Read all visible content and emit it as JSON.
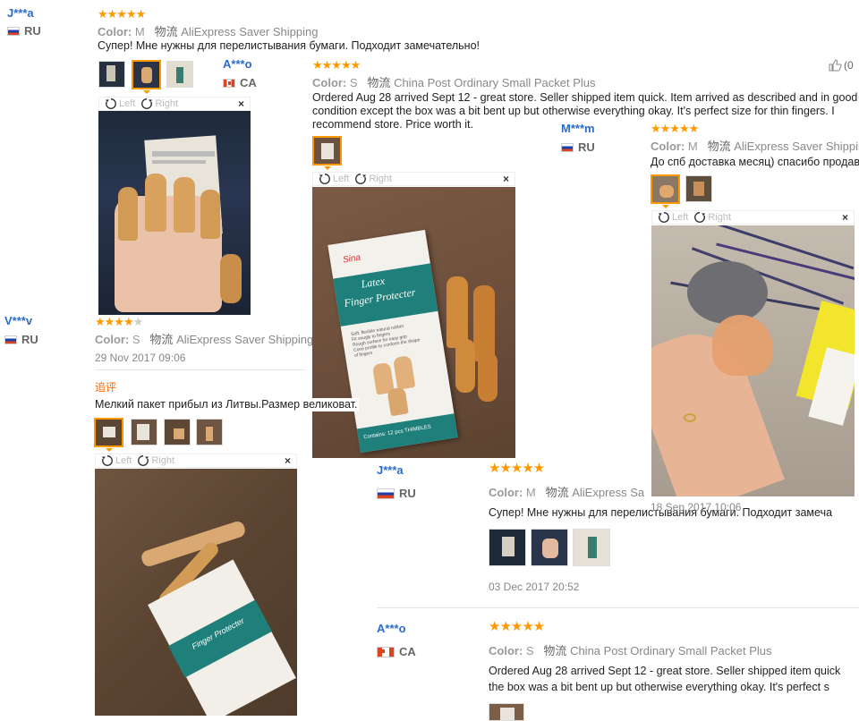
{
  "labels": {
    "color": "Color:",
    "left": "Left",
    "right": "Right",
    "close": "×",
    "shipping_cn": "物流",
    "append_tag": "追评"
  },
  "reviews": [
    {
      "id": "r1",
      "user": "J***a",
      "country": "RU",
      "rating": 5,
      "color": "M",
      "shipping": "AliExpress Saver Shipping",
      "text": "Супер! Мне нужны для перелистывания бумаги. Подходит замечательно!"
    },
    {
      "id": "r2",
      "user": "A***o",
      "country": "CA",
      "rating": 5,
      "color": "S",
      "shipping": "China Post Ordinary Small Packet Plus",
      "text": "Ordered Aug 28 arrived Sept 12 - great store. Seller shipped item quick. Item arrived as described and in good condition except the box was a bit bent up but otherwise everything okay. It's perfect size for thin fingers. I recommend store. Price worth it.",
      "helpful": "(0"
    },
    {
      "id": "r3",
      "user": "M***m",
      "country": "RU",
      "rating": 5,
      "color": "M",
      "shipping": "AliExpress Saver Shipping",
      "text": "До спб доставка месяц) спасибо продав",
      "date": "18 Sep 2017 10:06"
    },
    {
      "id": "r4",
      "user": "V***v",
      "country": "RU",
      "rating": 4,
      "color": "S",
      "shipping": "AliExpress Saver Shipping",
      "date": "29 Nov 2017 09:06",
      "append_text": "Мелкий пакет прибыл из Литвы.Размер великоват."
    },
    {
      "id": "r5",
      "user": "J***a",
      "country": "RU",
      "rating": 5,
      "color": "M",
      "shipping": "AliExpress Sa",
      "text": "Супер! Мне нужны для перелистывания бумаги. Подходит замеча",
      "date": "03 Dec 2017 20:52"
    },
    {
      "id": "r6",
      "user": "A***o",
      "country": "CA",
      "rating": 5,
      "color": "S",
      "shipping": "China Post Ordinary Small Packet Plus",
      "text_line1": "Ordered Aug 28 arrived Sept 12 - great store. Seller shipped item quick",
      "text_line2": "the box was a bit bent up but otherwise everything okay. It's perfect s"
    }
  ],
  "package": {
    "brand": "Sina",
    "title1": "Latex",
    "title2": "Finger Protecter",
    "contents": "Contains: 12 pcs THIMBLES",
    "bullets": [
      "Soft, flexible natural rubber",
      "Fit snugly to fingers",
      "Rough surface for easy grip",
      "Cone profile to conform the shape of fingers"
    ]
  },
  "colors": {
    "star": "#ff9900",
    "user": "#2a6cc7",
    "accent": "#ff9900",
    "teal": "#1f7f7a"
  }
}
